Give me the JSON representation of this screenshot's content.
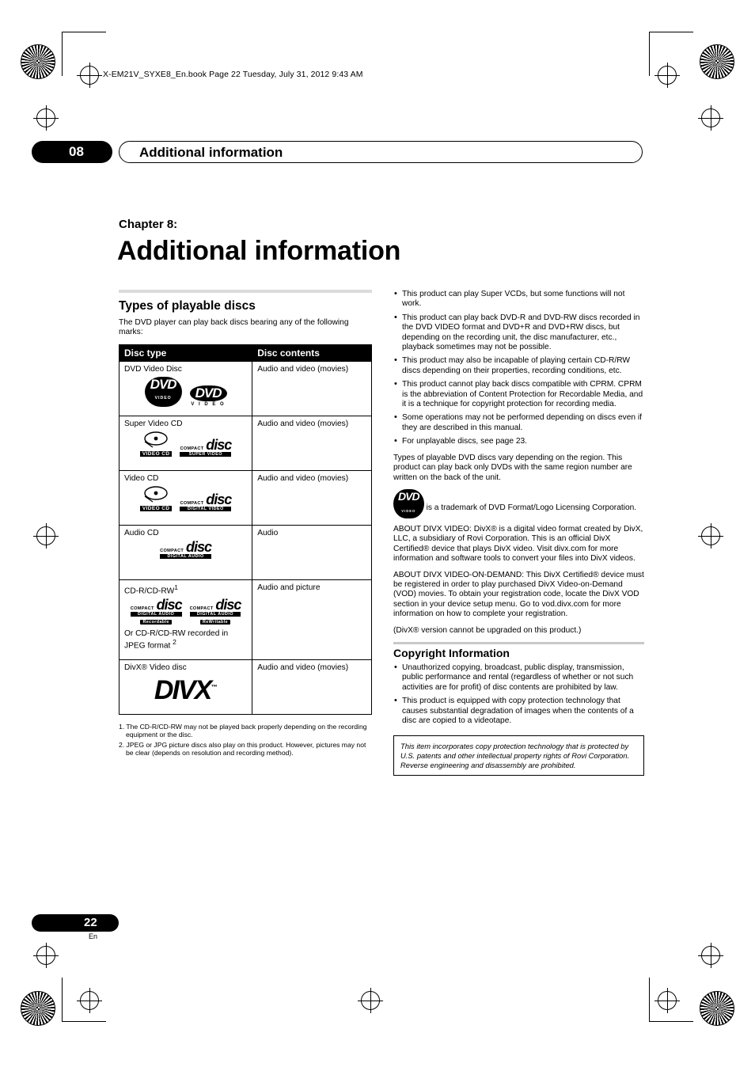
{
  "header": {
    "file_line": "X-EM21V_SYXE8_En.book  Page 22  Tuesday, July 31, 2012  9:43 AM"
  },
  "chapter_bar": {
    "number": "08",
    "title": "Additional information"
  },
  "title_block": {
    "chapter_label": "Chapter 8:",
    "title": "Additional information"
  },
  "left_column": {
    "section_title": "Types of playable discs",
    "intro": "The DVD player can play back discs bearing any of the following marks:",
    "table": {
      "headers": [
        "Disc type",
        "Disc contents"
      ],
      "rows": [
        {
          "type": "DVD Video Disc",
          "contents": "Audio and video (movies)",
          "logos": [
            "DVD VIDEO",
            "DVD VIDEO"
          ]
        },
        {
          "type": "Super Video CD",
          "contents": "Audio and video (movies)",
          "logos": [
            "VIDEO CD",
            "COMPACT disc SUPER VIDEO"
          ]
        },
        {
          "type": "Video CD",
          "contents": "Audio and video (movies)",
          "logos": [
            "VIDEO CD",
            "COMPACT disc DIGITAL VIDEO"
          ]
        },
        {
          "type": "Audio CD",
          "contents": "Audio",
          "logos": [
            "COMPACT disc DIGITAL AUDIO"
          ]
        },
        {
          "type": "CD-R/CD-RW",
          "type_sup": "1",
          "contents": "Audio and picture",
          "type_extra": "Or CD-R/CD-RW recorded in JPEG format",
          "type_extra_sup": "2",
          "logos": [
            "COMPACT disc DIGITAL AUDIO Recordable",
            "COMPACT disc DIGITAL AUDIO ReWritable"
          ]
        },
        {
          "type": "DivX® Video disc",
          "contents": "Audio and video (movies)",
          "logos": [
            "DIVX"
          ]
        }
      ]
    },
    "footnotes": [
      "1. The CD-R/CD-RW may not be played back properly depending on the recording equipment or the disc.",
      "2. JPEG or JPG picture discs also play on this product. However, pictures may not be clear (depends on resolution and recording method)."
    ]
  },
  "right_column": {
    "bullets": [
      "This product can play Super VCDs, but some functions will not work.",
      "This product can play back DVD-R and DVD-RW discs recorded in the DVD VIDEO format and DVD+R and DVD+RW discs, but depending on the recording unit, the disc manufacturer, etc., playback sometimes may not be possible.",
      "This product may also be incapable of playing certain CD-R/RW discs depending on their properties, recording conditions, etc.",
      "This product cannot play back discs compatible with CPRM. CPRM is the abbreviation of Content Protection for Recordable Media, and it is a technique for copyright protection for recording media.",
      "Some operations may not be performed depending on discs even if they are described in this manual.",
      "For unplayable discs, see page 23."
    ],
    "paragraphs": [
      "Types of playable DVD discs vary depending on the region. This product can play back only DVDs with the same region number are written on the back of the unit.",
      "is a trademark of DVD Format/Logo Licensing Corporation.",
      "ABOUT DIVX VIDEO: DivX® is a digital video format created by DivX, LLC, a subsidiary of Rovi Corporation. This is an official DivX Certified® device that plays DivX video. Visit divx.com for more information and software tools to convert your files into DivX videos.",
      "ABOUT DIVX VIDEO-ON-DEMAND: This DivX Certified® device must be registered in order to play purchased DivX Video-on-Demand (VOD) movies. To obtain your registration code, locate the DivX VOD section in your device setup menu. Go to vod.divx.com for more information on how to complete your registration.",
      "(DivX® version cannot be upgraded on this product.)"
    ],
    "copyright_heading": "Copyright Information",
    "copyright_bullets": [
      "Unauthorized copying, broadcast, public display, transmission, public performance and rental (regardless of whether or not such activities are for profit) of disc contents are prohibited by law.",
      "This product is equipped with copy protection technology that causes substantial degradation of images when the contents of a disc are copied to a videotape."
    ],
    "notice": "This item incorporates copy protection technology that is protected by U.S. patents and other intellectual property rights of Rovi Corporation. Reverse engineering and disassembly are prohibited."
  },
  "footer": {
    "page_number": "22",
    "language": "En"
  }
}
